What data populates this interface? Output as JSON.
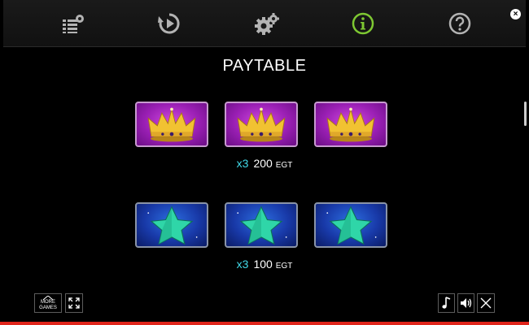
{
  "menu": {
    "items": [
      {
        "name": "paylines-settings-icon",
        "active": false
      },
      {
        "name": "autoplay-icon",
        "active": false
      },
      {
        "name": "settings-gears-icon",
        "active": false
      },
      {
        "name": "info-icon",
        "active": true
      },
      {
        "name": "help-icon",
        "active": false
      }
    ],
    "close_label": "×",
    "active_color": "#7ec832",
    "icon_color": "#b3b3b3"
  },
  "paytable": {
    "title": "PAYTABLE",
    "rows": [
      {
        "symbol": "crown",
        "count_label": "x3",
        "amount": "200",
        "currency": "EGT"
      },
      {
        "symbol": "star",
        "count_label": "x3",
        "amount": "100",
        "currency": "EGT"
      }
    ]
  },
  "footer": {
    "more_games_line1": "MORE",
    "more_games_line2": "GAMES"
  },
  "colors": {
    "multiplier": "#40d9e8",
    "bottom_bar": "#e1251b"
  }
}
